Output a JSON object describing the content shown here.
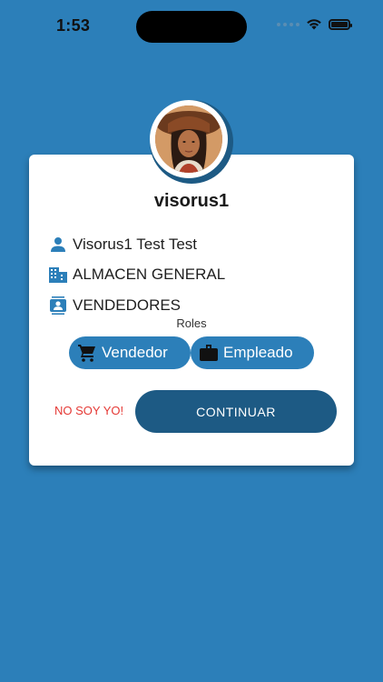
{
  "status_bar": {
    "time": "1:53"
  },
  "profile": {
    "username": "visorus1"
  },
  "info": {
    "full_name": "Visorus1 Test Test",
    "warehouse": "ALMACEN GENERAL",
    "department": "VENDEDORES"
  },
  "roles": {
    "title": "Roles",
    "items": [
      {
        "label": "Vendedor",
        "icon": "cart-icon"
      },
      {
        "label": "Empleado",
        "icon": "briefcase-icon"
      }
    ]
  },
  "actions": {
    "not_me": "NO SOY YO!",
    "continue": "CONTINUAR"
  },
  "colors": {
    "background": "#2c7fb9",
    "primary_dark": "#1d5a84",
    "chip": "#2c7fb9",
    "danger": "#e53935",
    "card": "#ffffff"
  }
}
